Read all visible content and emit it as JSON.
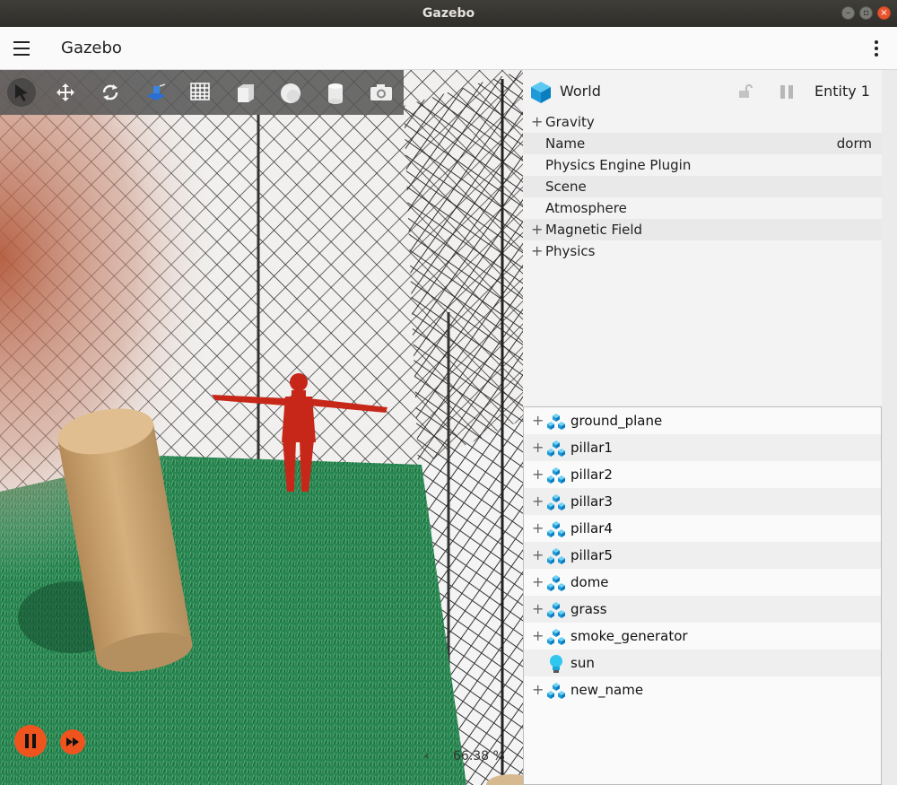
{
  "window": {
    "title": "Gazebo",
    "buttons": [
      "minimize",
      "maximize",
      "close"
    ]
  },
  "appbar": {
    "title": "Gazebo",
    "menu_icon": "hamburger-menu-icon",
    "more_icon": "more-vert-icon"
  },
  "toolbar": {
    "tools": [
      {
        "name": "select-tool",
        "icon": "cursor-arrow-icon",
        "active": true
      },
      {
        "name": "translate-tool",
        "icon": "move-arrows-icon"
      },
      {
        "name": "rotate-tool",
        "icon": "rotate-icon"
      },
      {
        "name": "transform-control-tool",
        "icon": "transform-icon"
      },
      {
        "name": "grid-tool",
        "icon": "grid-icon"
      },
      {
        "name": "box-tool",
        "icon": "box-icon"
      },
      {
        "name": "sphere-tool",
        "icon": "sphere-icon"
      },
      {
        "name": "cylinder-tool",
        "icon": "cylinder-icon"
      },
      {
        "name": "screenshot-tool",
        "icon": "camera-icon"
      }
    ]
  },
  "playback": {
    "pause_icon": "pause-icon",
    "step_icon": "fast-forward-icon",
    "rtf_arrow": "‹",
    "rtf": "66.38 %",
    "accent": "#f0541e"
  },
  "component_inspector": {
    "title": "World",
    "entity": "Entity 1",
    "properties": [
      {
        "label": "Gravity",
        "expandable": true,
        "value": ""
      },
      {
        "label": "Name",
        "expandable": false,
        "value": "dorm"
      },
      {
        "label": "Physics Engine Plugin",
        "expandable": false,
        "value": ""
      },
      {
        "label": "Scene",
        "expandable": false,
        "value": ""
      },
      {
        "label": "Atmosphere",
        "expandable": false,
        "value": ""
      },
      {
        "label": "Magnetic Field",
        "expandable": true,
        "value": ""
      },
      {
        "label": "Physics",
        "expandable": true,
        "value": ""
      }
    ]
  },
  "entity_tree": {
    "items": [
      {
        "name": "ground_plane",
        "type": "model",
        "expandable": true
      },
      {
        "name": "pillar1",
        "type": "model",
        "expandable": true
      },
      {
        "name": "pillar2",
        "type": "model",
        "expandable": true
      },
      {
        "name": "pillar3",
        "type": "model",
        "expandable": true
      },
      {
        "name": "pillar4",
        "type": "model",
        "expandable": true
      },
      {
        "name": "pillar5",
        "type": "model",
        "expandable": true
      },
      {
        "name": "dome",
        "type": "model",
        "expandable": true
      },
      {
        "name": "grass",
        "type": "model",
        "expandable": true
      },
      {
        "name": "smoke_generator",
        "type": "model",
        "expandable": true
      },
      {
        "name": "sun",
        "type": "light",
        "expandable": false
      },
      {
        "name": "new_name",
        "type": "model",
        "expandable": true
      }
    ]
  }
}
